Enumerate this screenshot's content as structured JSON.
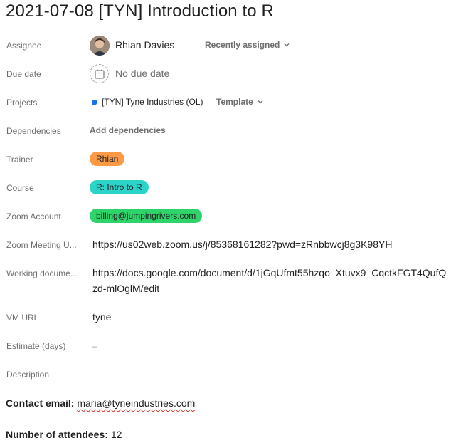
{
  "task": {
    "title": "2021-07-08 [TYN] Introduction to R"
  },
  "fields": {
    "assignee": {
      "label": "Assignee",
      "name": "Rhian Davies",
      "dropdown": "Recently assigned"
    },
    "due_date": {
      "label": "Due date",
      "value": "No due date"
    },
    "projects": {
      "label": "Projects",
      "project": "[TYN] Tyne Industries (OL)",
      "project_color": "#1a73e8",
      "section": "Template"
    },
    "dependencies": {
      "label": "Dependencies",
      "action": "Add dependencies"
    },
    "trainer": {
      "label": "Trainer",
      "value": "Rhian",
      "color": "#fd9a45"
    },
    "course": {
      "label": "Course",
      "value": "R: Intro to R",
      "color": "#2bd3c8"
    },
    "zoom_account": {
      "label": "Zoom Account",
      "value": "billing@jumpingrivers.com",
      "color": "#2ed36a"
    },
    "zoom_meeting_url": {
      "label": "Zoom Meeting U...",
      "value": "https://us02web.zoom.us/j/85368161282?pwd=zRnbbwcj8g3K98YH"
    },
    "working_document": {
      "label": "Working docume...",
      "value": "https://docs.google.com/document/d/1jGqUfmt55hzqo_Xtuvx9_CqctkFGT4QufQzd-mlOglM/edit"
    },
    "vm_url": {
      "label": "VM URL",
      "value": "tyne"
    },
    "estimate": {
      "label": "Estimate (days)",
      "value": "–"
    },
    "description": {
      "label": "Description"
    }
  },
  "description": {
    "contact_label": "Contact email:",
    "contact_value": "maria@tyneindustries.com",
    "attendees_label": "Number of attendees:",
    "attendees_value": "12"
  }
}
